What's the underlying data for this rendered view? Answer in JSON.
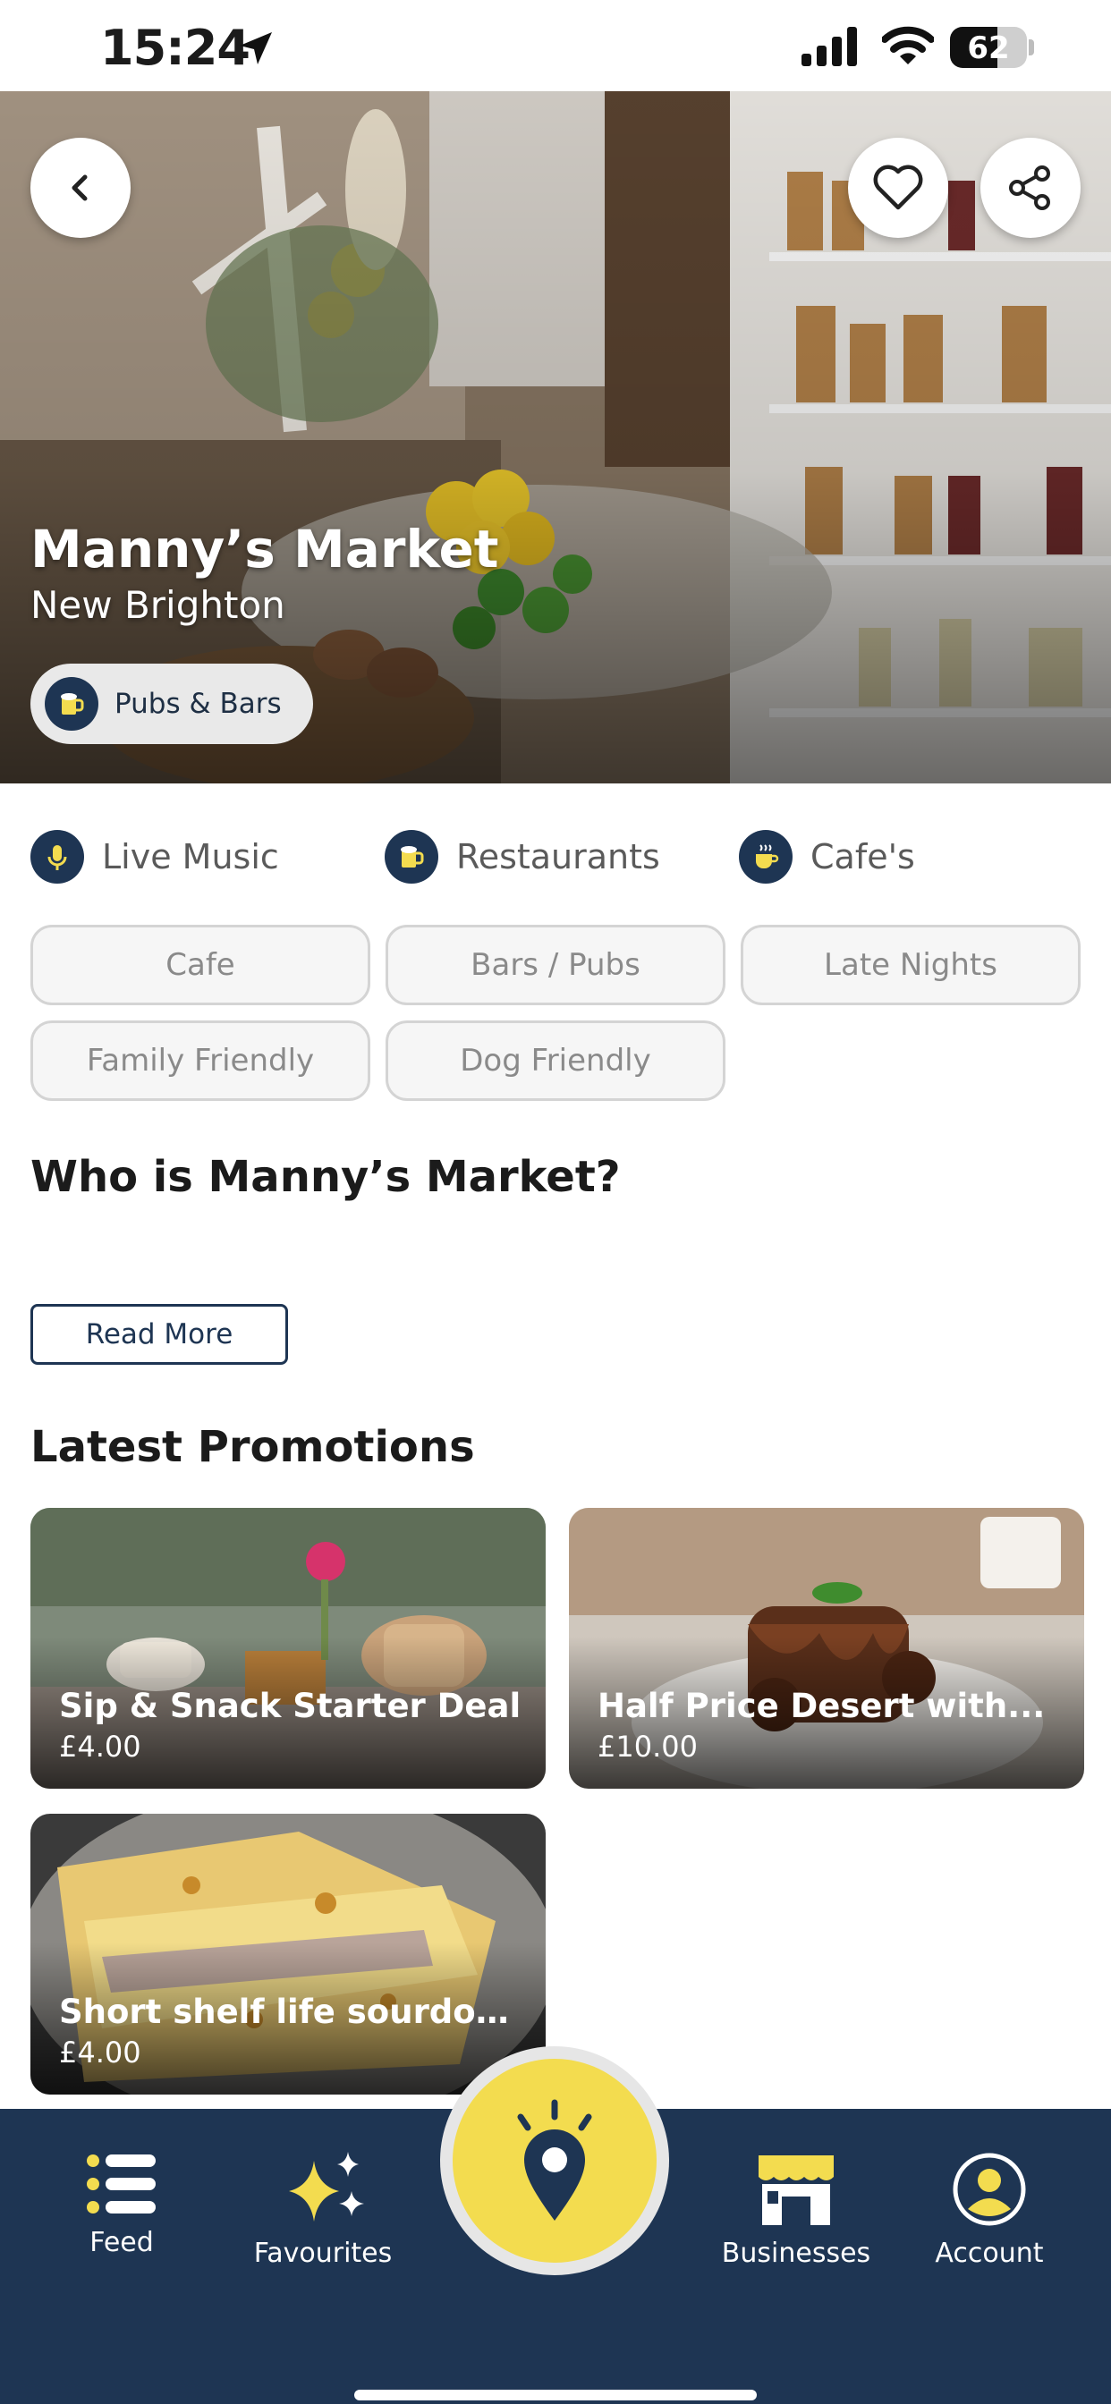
{
  "status_bar": {
    "time": "15:24",
    "battery_level": "62",
    "icons": [
      "location-arrow-icon",
      "signal-icon",
      "wifi-icon",
      "battery-icon"
    ]
  },
  "hero": {
    "title": "Manny’s Market",
    "location": "New Brighton",
    "category_chip": "Pubs & Bars",
    "buttons": [
      "back-icon",
      "heart-icon",
      "share-icon"
    ]
  },
  "categories": [
    {
      "label": "Live Music",
      "icon": "microphone-icon"
    },
    {
      "label": "Restaurants",
      "icon": "beer-mug-icon"
    },
    {
      "label": "Cafe's",
      "icon": "coffee-cup-icon"
    }
  ],
  "tags": [
    "Cafe",
    "Bars / Pubs",
    "Late Nights",
    "Family Friendly",
    "Dog Friendly"
  ],
  "about": {
    "title": "Who is Manny’s Market?",
    "read_more": "Read More"
  },
  "promotions": {
    "title": "Latest Promotions",
    "items": [
      {
        "title": "Sip & Snack Starter Deal",
        "price": "£4.00"
      },
      {
        "title": "Half Price Desert with...",
        "price": "£10.00"
      },
      {
        "title": "Short shelf life sourdou...",
        "price": "£4.00"
      }
    ]
  },
  "bottom_nav": {
    "items": [
      {
        "label": "Feed",
        "icon": "list-icon"
      },
      {
        "label": "Favourites",
        "icon": "sparkles-icon"
      },
      {
        "label": "Businesses",
        "icon": "storefront-icon"
      },
      {
        "label": "Account",
        "icon": "user-circle-icon"
      }
    ],
    "center_icon": "map-pin-icon"
  },
  "colors": {
    "navy": "#1e3553",
    "yellow": "#f3dc4f",
    "pill_border": "#d4d4d4"
  }
}
